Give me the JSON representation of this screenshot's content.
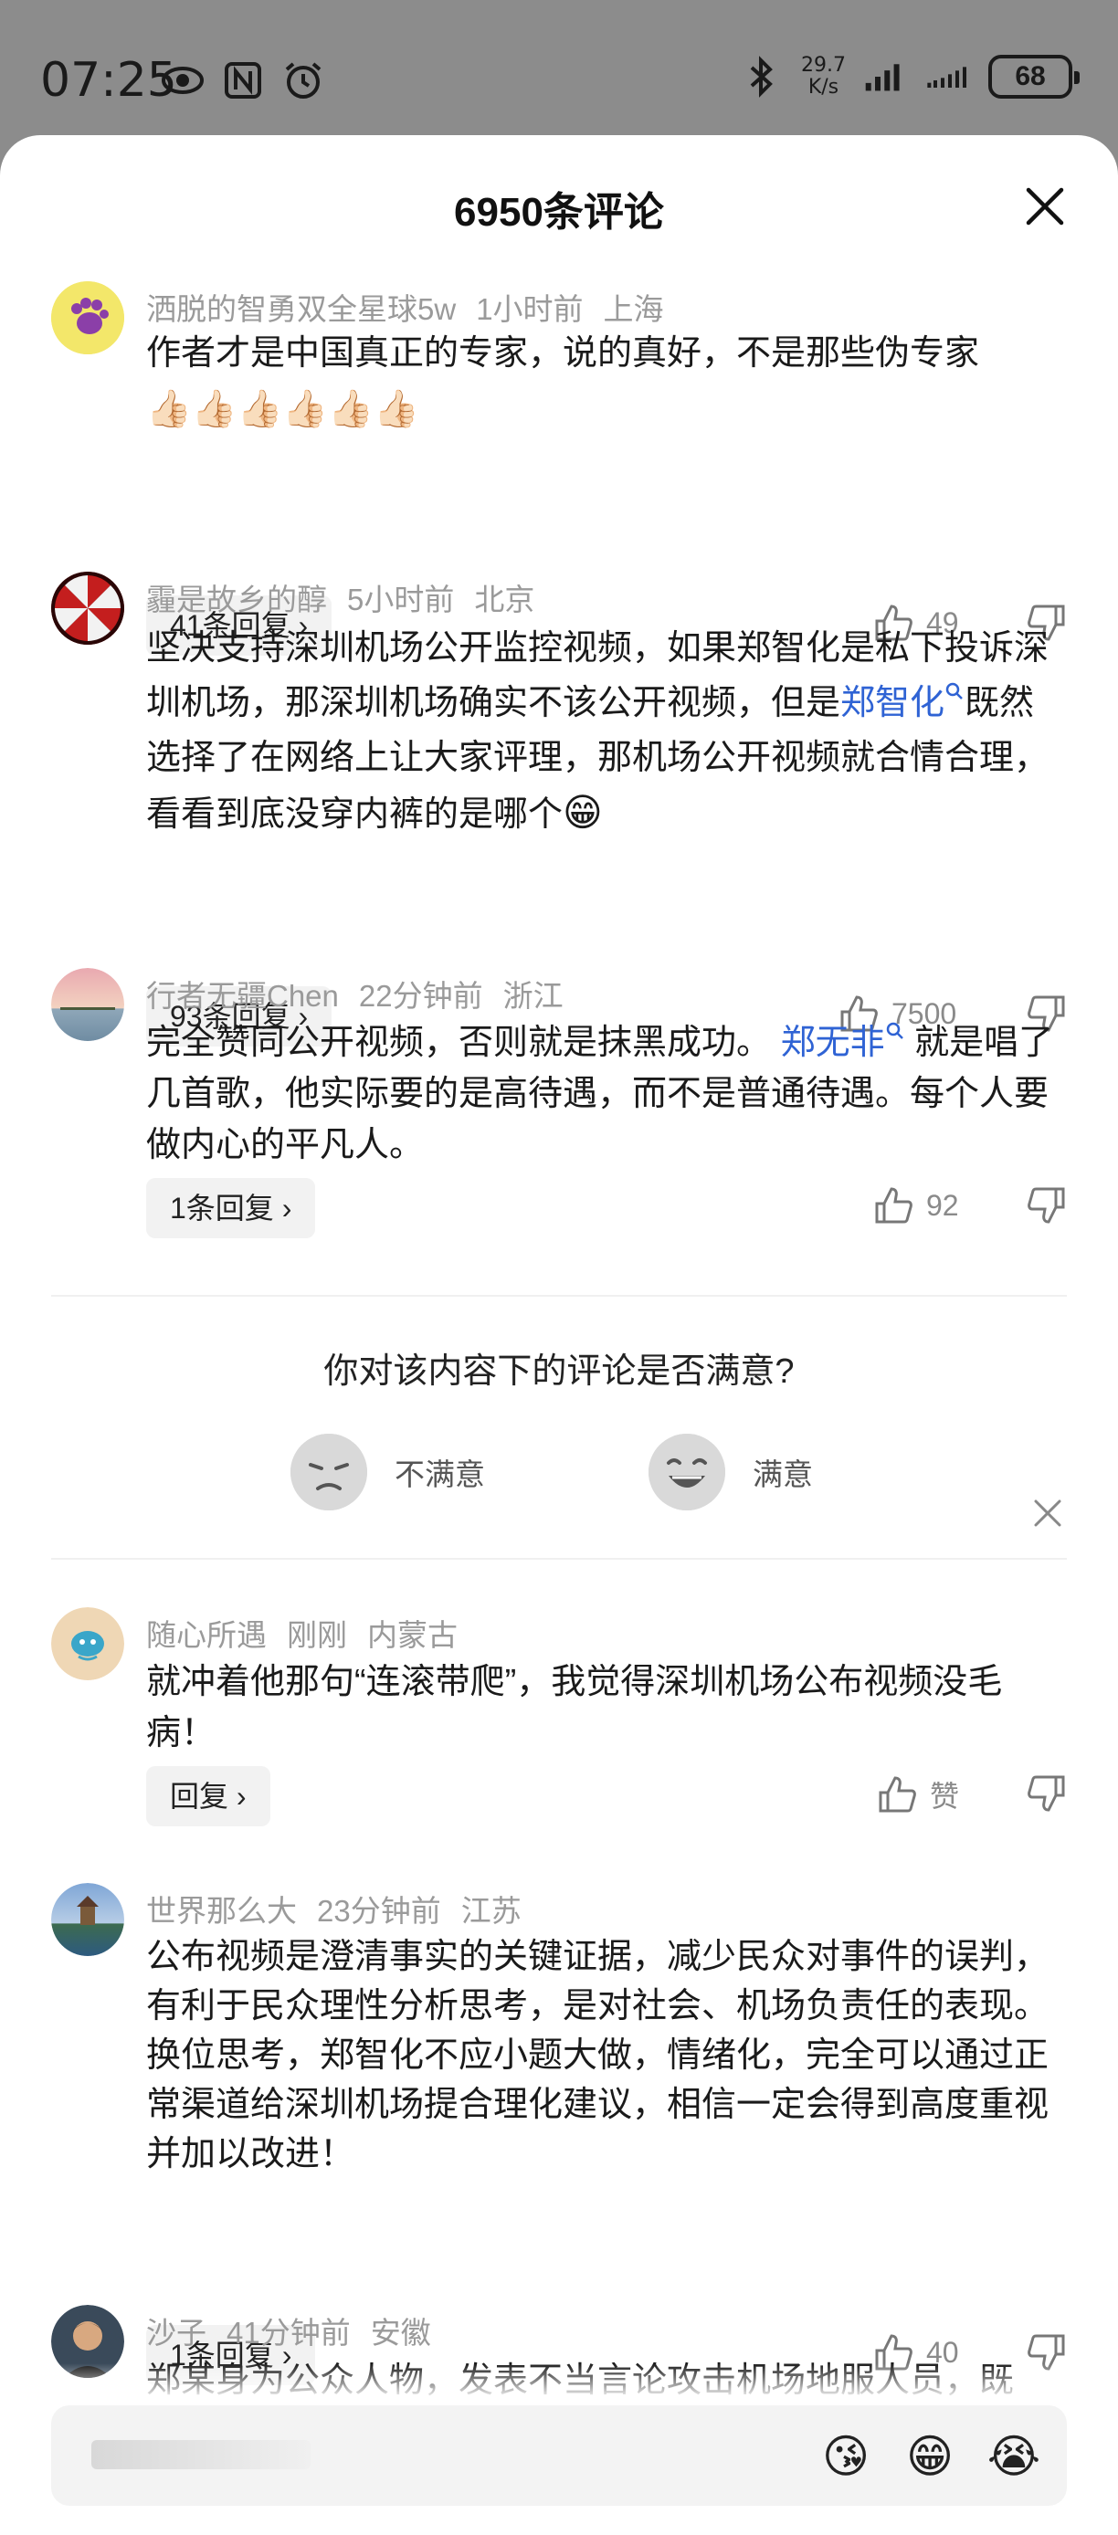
{
  "status_bar": {
    "time": "07:25",
    "net_speed_value": "29.7",
    "net_speed_unit": "K/s",
    "battery": "68"
  },
  "sheet": {
    "title": "6950条评论"
  },
  "comments": [
    {
      "user": "洒脱的智勇双全星球5w",
      "time": "1小时前",
      "location": "上海",
      "text": "作者才是中国真正的专家，说的真好，不是那些伪专家",
      "emoji_line": "👍🏻👍🏻👍🏻👍🏻👍🏻👍🏻",
      "replies": "41条回复",
      "likes": "49"
    },
    {
      "user": "霾是故乡的醇",
      "time": "5小时前",
      "location": "北京",
      "text_1": "坚决支持深圳机场公开监控视频，如果郑智化是私下投诉深圳机场，那深圳机场确实不该公开视频，但是",
      "mention": "郑智化",
      "text_2": "既然选择了在网络上让大家评理，那机场公开视频就合情合理，看看到底没穿内裤的是哪个",
      "emoji": "😁",
      "replies": "93条回复",
      "likes": "7500"
    },
    {
      "user": "行者无疆Chen",
      "time": "22分钟前",
      "location": "浙江",
      "text_1": "完全赞同公开视频，否则就是抹黑成功。",
      "mention": "郑无非",
      "text_2": "就是唱了几首歌，他实际要的是高待遇，而不是普通待遇。每个人要做内心的平凡人。",
      "replies": "1条回复",
      "likes": "92"
    },
    {
      "user": "随心所遇",
      "time": "刚刚",
      "location": "内蒙古",
      "text": "就冲着他那句“连滚带爬”，我觉得深圳机场公布视频没毛病！",
      "replies": "回复",
      "likes": "赞"
    },
    {
      "user": "世界那么大",
      "time": "23分钟前",
      "location": "江苏",
      "text": "公布视频是澄清事实的关键证据，减少民众对事件的误判，有利于民众理性分析思考，是对社会、机场负责任的表现。换位思考，郑智化不应小题大做，情绪化，完全可以通过正常渠道给深圳机场提合理化建议，相信一定会得到高度重视并加以改进！",
      "replies": "1条回复",
      "likes": "40"
    },
    {
      "user": "沙子",
      "time": "41分钟前",
      "location": "安徽",
      "text": "郑某身为公众人物，发表不当言论攻击机场地服人员，既"
    }
  ],
  "survey": {
    "question": "你对该内容下的评论是否满意?",
    "option_bad": "不满意",
    "option_good": "满意"
  },
  "input_bar": {
    "emoji_1": "😘",
    "emoji_2": "😁",
    "emoji_3": "😭"
  },
  "colors": {
    "mention": "#2f63d4",
    "meta": "#9a9a9a",
    "status_bar_bg": "#8c8c8c"
  }
}
